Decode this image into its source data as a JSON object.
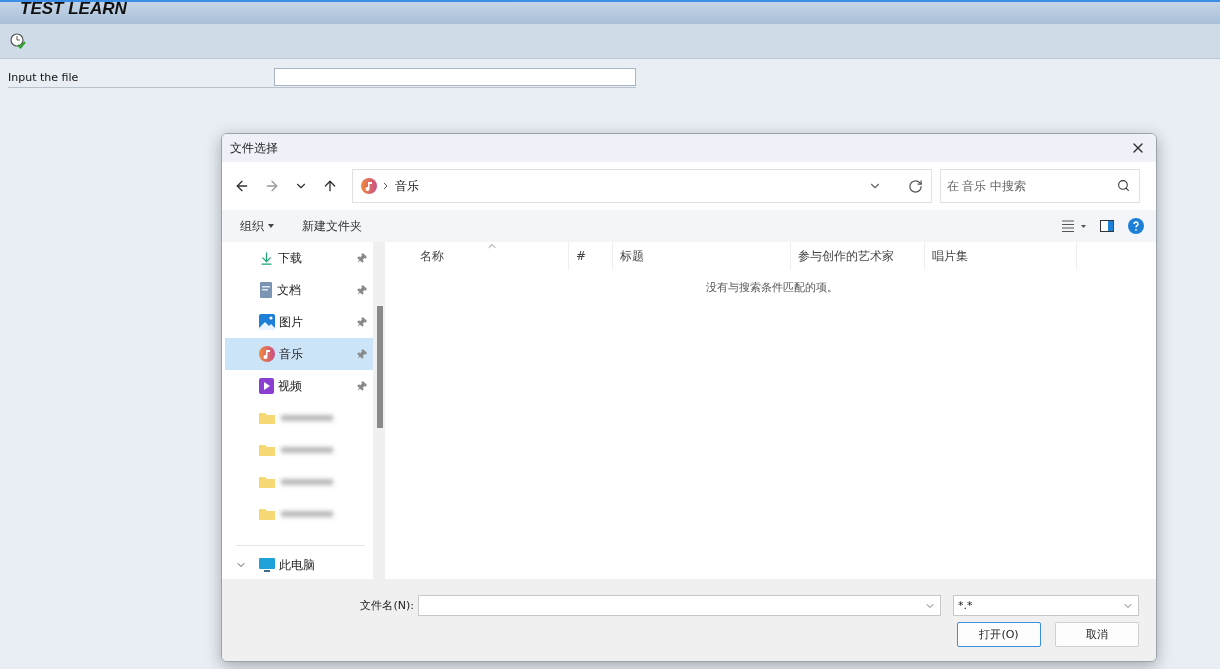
{
  "page": {
    "title": "TEST LEARN",
    "form": {
      "label": "Input the file"
    }
  },
  "dialog": {
    "title": "文件选择",
    "address": {
      "location": "音乐"
    },
    "search": {
      "placeholder": "在 音乐 中搜索"
    },
    "commands": [
      {
        "label": "组织",
        "kind": "menu"
      },
      {
        "label": "新建文件夹",
        "kind": "plain"
      }
    ],
    "nav_items": [
      {
        "kind": "downloads",
        "label": "下载",
        "selected": false,
        "pinned": true
      },
      {
        "kind": "documents",
        "label": "文档",
        "selected": false,
        "pinned": true
      },
      {
        "kind": "pictures",
        "label": "图片",
        "selected": false,
        "pinned": true
      },
      {
        "kind": "music",
        "label": "音乐",
        "selected": true,
        "pinned": true
      },
      {
        "kind": "videos",
        "label": "视频",
        "selected": false,
        "pinned": true
      },
      {
        "kind": "blurred",
        "selected": false
      },
      {
        "kind": "blurred",
        "selected": false
      },
      {
        "kind": "blurred",
        "selected": false
      },
      {
        "kind": "blurred",
        "selected": false
      },
      {
        "kind": "separator"
      },
      {
        "kind": "pc",
        "label": "此电脑",
        "selected": false,
        "expanded": true
      }
    ],
    "columns": [
      {
        "label": "名称",
        "sorted": true
      },
      {
        "label": "#",
        "sorted": false
      },
      {
        "label": "标题",
        "sorted": false
      },
      {
        "label": "参与创作的艺术家",
        "sorted": false
      },
      {
        "label": "唱片集",
        "sorted": false
      }
    ],
    "empty_message": "没有与搜索条件匹配的项。",
    "filename_label": "文件名(N):",
    "filter": "*.*",
    "buttons": [
      {
        "label": "打开(O)",
        "default": true
      },
      {
        "label": "取消",
        "default": false
      }
    ]
  }
}
